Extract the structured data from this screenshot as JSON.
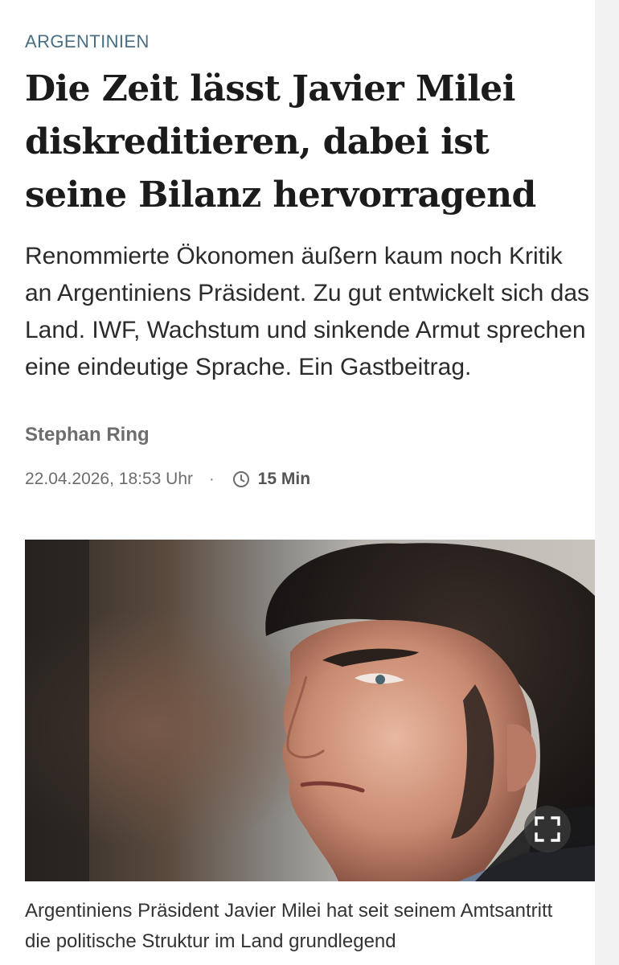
{
  "article": {
    "kicker": "ARGENTINIEN",
    "headline": "Die Zeit lässt Javier Milei diskreditieren, dabei ist seine Bilanz hervorragend",
    "teaser": "Renommierte Ökonomen äußern kaum noch Kritik an Argentiniens Präsident. Zu gut entwickelt sich das Land. IWF, Wachstum und sinkende Armut sprechen eine eindeutige Sprache. Ein Gastbeitrag.",
    "author": "Stephan Ring",
    "date": "22.04.2026, 18:53 Uhr",
    "separator": "·",
    "read_time": "15 Min",
    "clock_icon": "clock-icon",
    "image_caption": "Argentiniens Präsident Javier Milei hat seit seinem Amtsantritt die politische Struktur im Land grundlegend",
    "expand_icon": "fullscreen-icon"
  },
  "colors": {
    "kicker": "#4a6e82",
    "headline": "#1b1b1b",
    "meta": "#6d6d6d"
  }
}
